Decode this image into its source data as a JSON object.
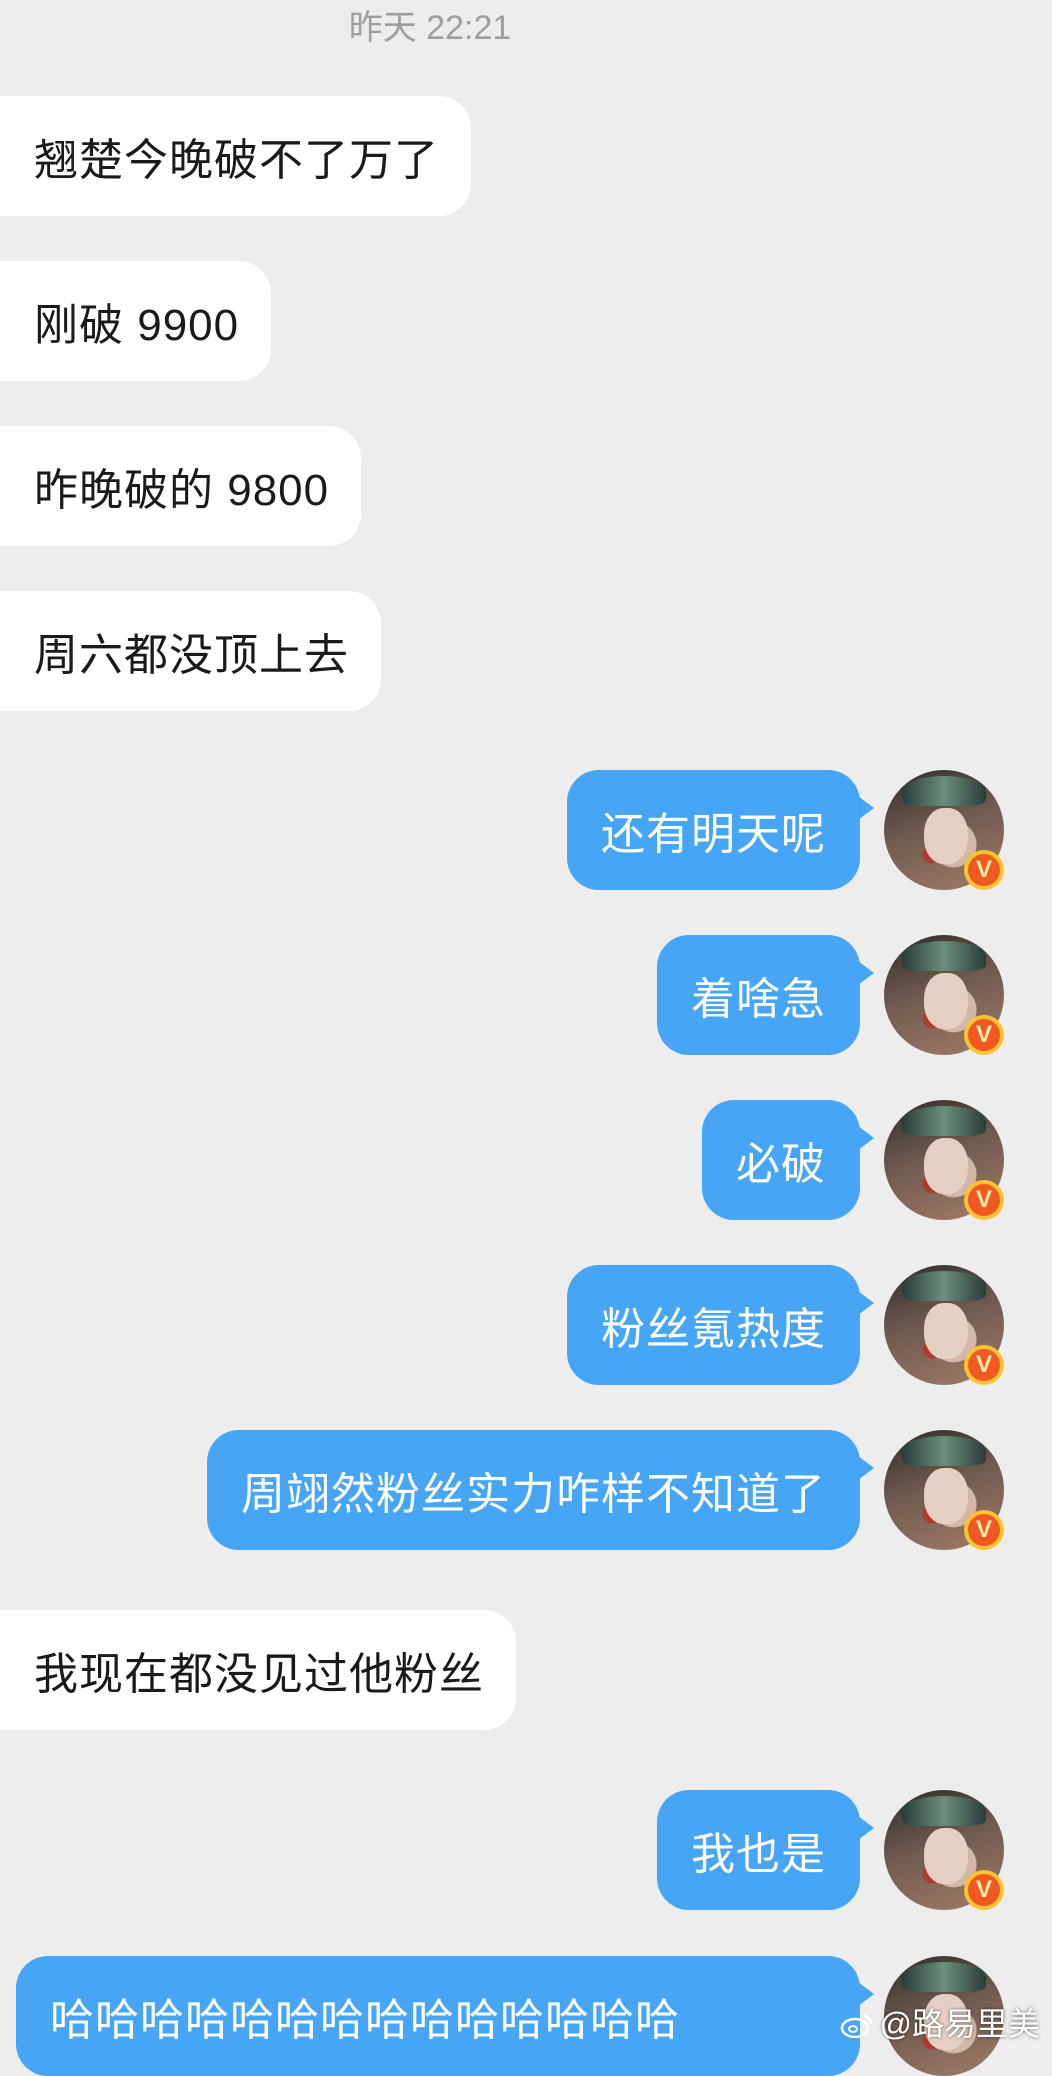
{
  "chat": {
    "timestamp": "昨天 22:21",
    "messages": [
      {
        "side": "in",
        "text": "翘楚今晚破不了万了"
      },
      {
        "side": "in",
        "text": "刚破 9900"
      },
      {
        "side": "in",
        "text": "昨晚破的 9800"
      },
      {
        "side": "in",
        "text": "周六都没顶上去"
      },
      {
        "side": "out",
        "text": "还有明天呢"
      },
      {
        "side": "out",
        "text": "着啥急"
      },
      {
        "side": "out",
        "text": "必破"
      },
      {
        "side": "out",
        "text": "粉丝氪热度"
      },
      {
        "side": "out",
        "text": "周翊然粉丝实力咋样不知道了"
      },
      {
        "side": "in",
        "text": "我现在都没见过他粉丝"
      },
      {
        "side": "out",
        "text": "我也是"
      },
      {
        "side": "out",
        "text": "哈哈哈哈哈哈哈哈哈哈哈哈哈哈"
      }
    ],
    "verified_badge": "V"
  },
  "watermark": {
    "text": "@路易里美"
  },
  "colors": {
    "background": "#ededed",
    "incoming_bubble": "#ffffff",
    "outgoing_bubble": "#46a5f5",
    "badge": "#f05a22"
  },
  "icons": {
    "avatar": "user-avatar",
    "badge": "verified-badge-icon",
    "watermark": "weibo-logo-icon"
  }
}
